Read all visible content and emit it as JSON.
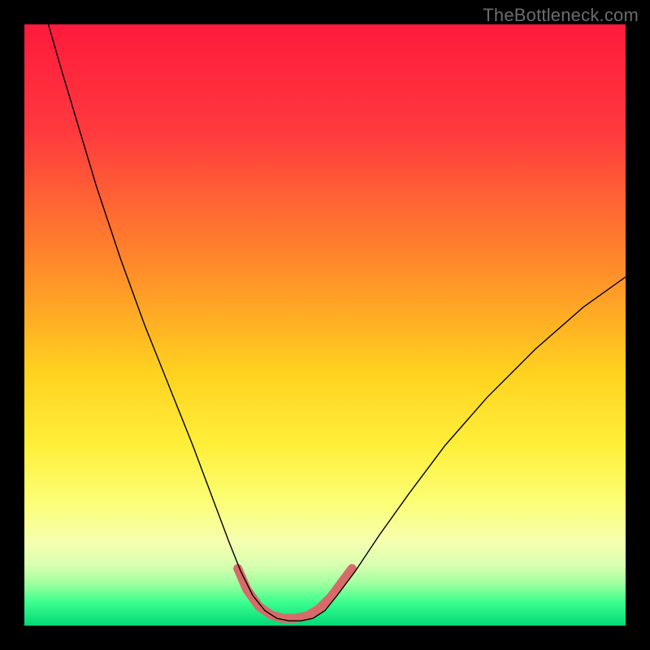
{
  "watermark": "TheBottleneck.com",
  "chart_data": {
    "type": "line",
    "title": "",
    "xlabel": "",
    "ylabel": "",
    "xlim": [
      0,
      100
    ],
    "ylim": [
      0,
      100
    ],
    "gradient_stops": [
      {
        "offset": 0,
        "color": "#ff1a3c"
      },
      {
        "offset": 18,
        "color": "#ff3a3e"
      },
      {
        "offset": 40,
        "color": "#ff8a2a"
      },
      {
        "offset": 58,
        "color": "#ffd21f"
      },
      {
        "offset": 70,
        "color": "#ffef3a"
      },
      {
        "offset": 80,
        "color": "#fbff7a"
      },
      {
        "offset": 86,
        "color": "#f6ffb0"
      },
      {
        "offset": 90,
        "color": "#d8ffb0"
      },
      {
        "offset": 93,
        "color": "#9fff9f"
      },
      {
        "offset": 96,
        "color": "#3fff8f"
      },
      {
        "offset": 100,
        "color": "#00d977"
      }
    ],
    "series": [
      {
        "name": "curve",
        "color": "#000000",
        "width": 1.4,
        "points": [
          {
            "x": 4,
            "y": 100
          },
          {
            "x": 6,
            "y": 93
          },
          {
            "x": 9,
            "y": 83
          },
          {
            "x": 12,
            "y": 73
          },
          {
            "x": 16,
            "y": 61
          },
          {
            "x": 20,
            "y": 50
          },
          {
            "x": 24,
            "y": 40
          },
          {
            "x": 28,
            "y": 30
          },
          {
            "x": 31,
            "y": 22
          },
          {
            "x": 34,
            "y": 14
          },
          {
            "x": 36,
            "y": 9
          },
          {
            "x": 38,
            "y": 5
          },
          {
            "x": 40,
            "y": 2.5
          },
          {
            "x": 42,
            "y": 1.2
          },
          {
            "x": 44,
            "y": 0.8
          },
          {
            "x": 46,
            "y": 0.8
          },
          {
            "x": 48,
            "y": 1.2
          },
          {
            "x": 50,
            "y": 2.5
          },
          {
            "x": 52,
            "y": 5
          },
          {
            "x": 55,
            "y": 9
          },
          {
            "x": 59,
            "y": 15
          },
          {
            "x": 64,
            "y": 22
          },
          {
            "x": 70,
            "y": 30
          },
          {
            "x": 77,
            "y": 38
          },
          {
            "x": 85,
            "y": 46
          },
          {
            "x": 93,
            "y": 53
          },
          {
            "x": 100,
            "y": 58
          }
        ]
      },
      {
        "name": "valley-highlight",
        "color": "#d86a6a",
        "width": 11,
        "linecap": "round",
        "points": [
          {
            "x": 35.5,
            "y": 9.5
          },
          {
            "x": 37,
            "y": 6
          },
          {
            "x": 39,
            "y": 3.2
          },
          {
            "x": 41,
            "y": 1.8
          },
          {
            "x": 43,
            "y": 1.2
          },
          {
            "x": 45,
            "y": 1.2
          },
          {
            "x": 47,
            "y": 1.6
          },
          {
            "x": 49,
            "y": 2.8
          },
          {
            "x": 51,
            "y": 4.8
          },
          {
            "x": 53,
            "y": 7.5
          },
          {
            "x": 54.5,
            "y": 9.5
          }
        ]
      }
    ]
  }
}
